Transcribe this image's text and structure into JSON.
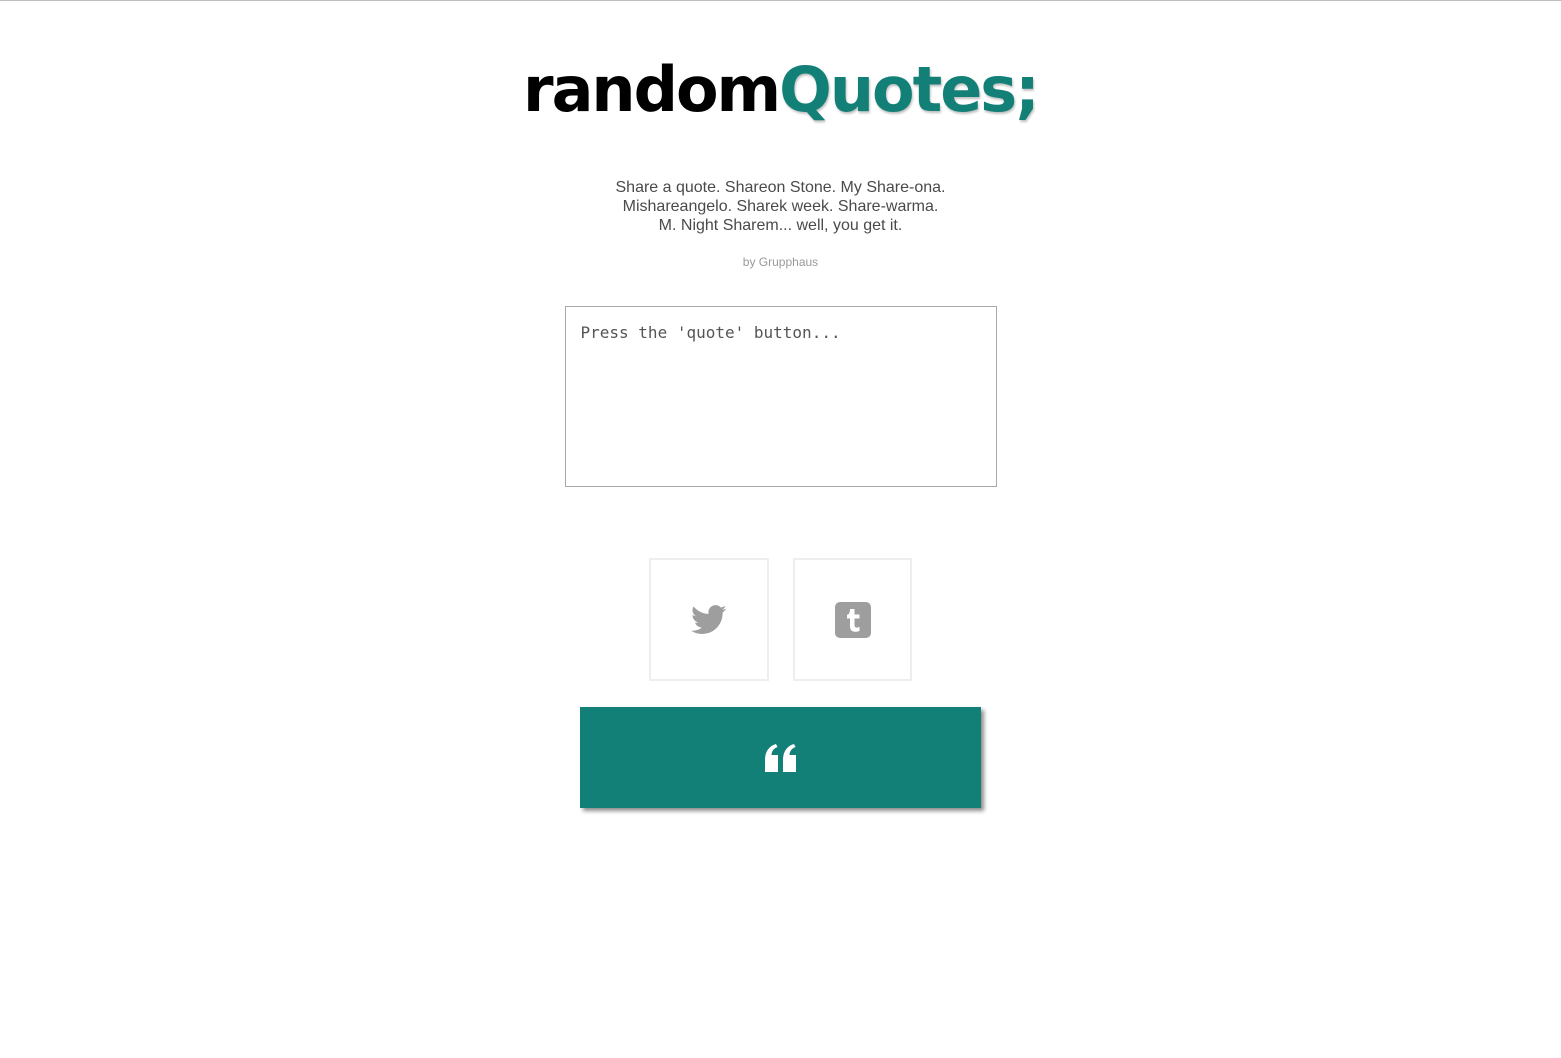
{
  "header": {
    "logo_part1": "random",
    "logo_part2": "Quotes;"
  },
  "tagline": {
    "line1": "Share a quote. Shareon Stone. My Share-ona.",
    "line2": "Mishareangelo. Sharek week. Share-warma.",
    "line3": "M. Night Sharem... well, you get it."
  },
  "byline": "by Grupphaus",
  "quote_box": {
    "text": "Press the 'quote' button..."
  },
  "share": {
    "twitter_icon": "twitter-bird-icon",
    "tumblr_icon": "tumblr-icon"
  },
  "quote_button": {
    "icon": "quote-mark-icon"
  },
  "colors": {
    "accent": "#138078",
    "icon_gray": "#9e9e9e"
  }
}
